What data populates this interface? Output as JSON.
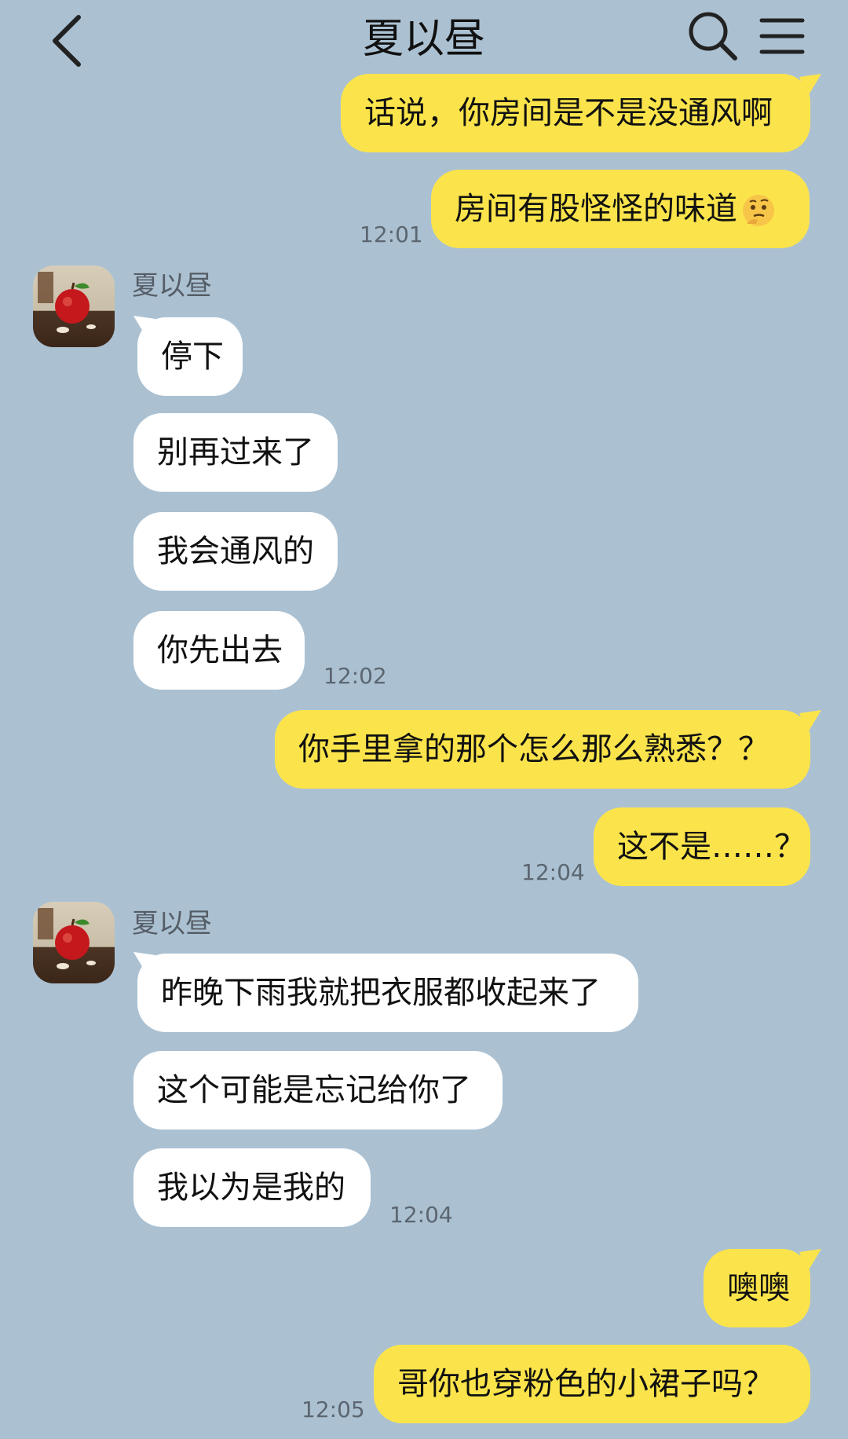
{
  "header": {
    "title": "夏以昼"
  },
  "contact_name": "夏以昼",
  "messages": [
    {
      "text": "话说，你房间是不是没通风啊"
    },
    {
      "text": "房间有股怪怪的味道",
      "emoji": "thinking-face-emoji"
    },
    {
      "text": "停下"
    },
    {
      "text": "别再过来了"
    },
    {
      "text": "我会通风的"
    },
    {
      "text": "你先出去"
    },
    {
      "text": "你手里拿的那个怎么那么熟悉？？"
    },
    {
      "text": "这不是……？"
    },
    {
      "text": "昨晚下雨我就把衣服都收起来了"
    },
    {
      "text": "这个可能是忘记给你了"
    },
    {
      "text": "我以为是我的"
    },
    {
      "text": "噢噢"
    },
    {
      "text": "哥你也穿粉色的小裙子吗？"
    }
  ],
  "times": [
    "12:01",
    "12:02",
    "12:04",
    "12:04",
    "12:05"
  ],
  "colors": {
    "background": "#abc1d2",
    "outgoing_bubble": "#fbe44b",
    "incoming_bubble": "#ffffff"
  },
  "icons": [
    "back-chevron-icon",
    "search-icon",
    "menu-icon",
    "avatar-apple-image"
  ]
}
